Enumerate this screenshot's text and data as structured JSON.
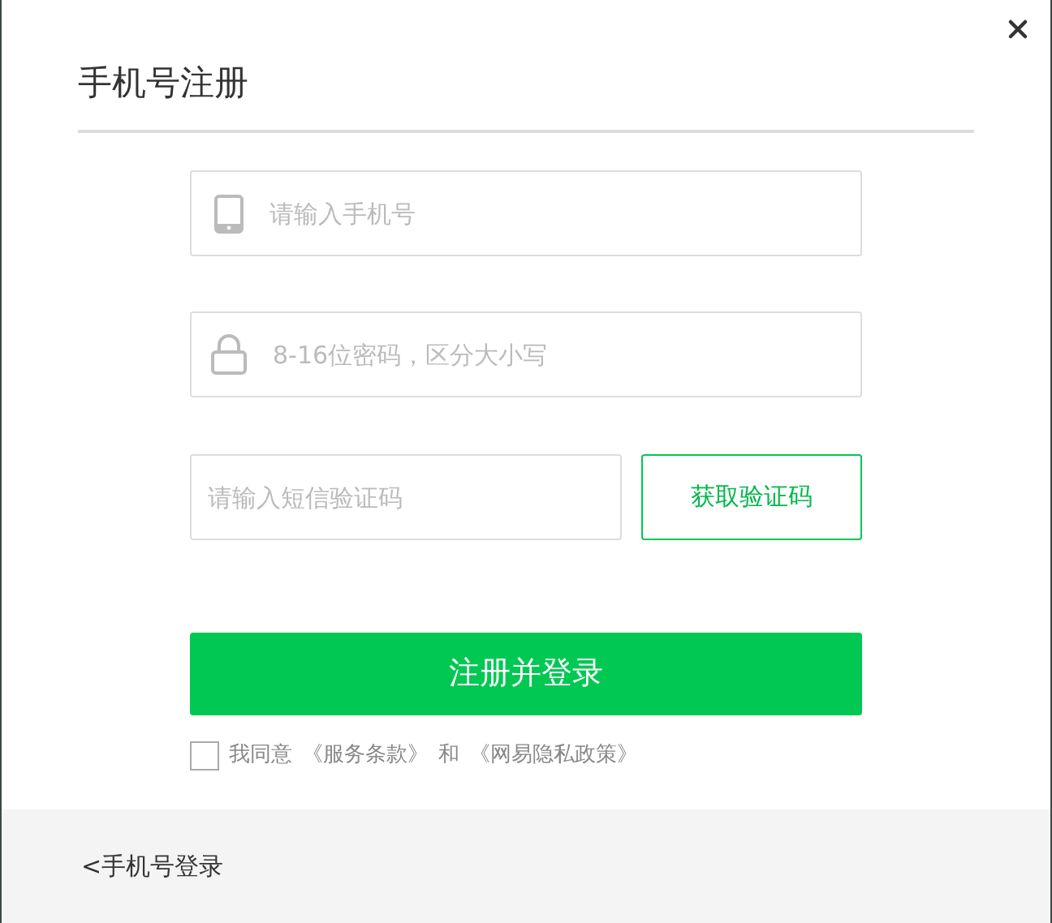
{
  "title": "手机号注册",
  "phone": {
    "placeholder": "请输入手机号"
  },
  "password": {
    "placeholder": "8-16位密码，区分大小写"
  },
  "code": {
    "placeholder": "请输入短信验证码"
  },
  "get_code_button": "获取验证码",
  "submit_button": "注册并登录",
  "agreement": {
    "checked": false,
    "prefix": "我同意",
    "terms_link": "《服务条款》",
    "and": "和",
    "privacy_link": "《网易隐私政策》"
  },
  "footer_link": "<手机号登录"
}
